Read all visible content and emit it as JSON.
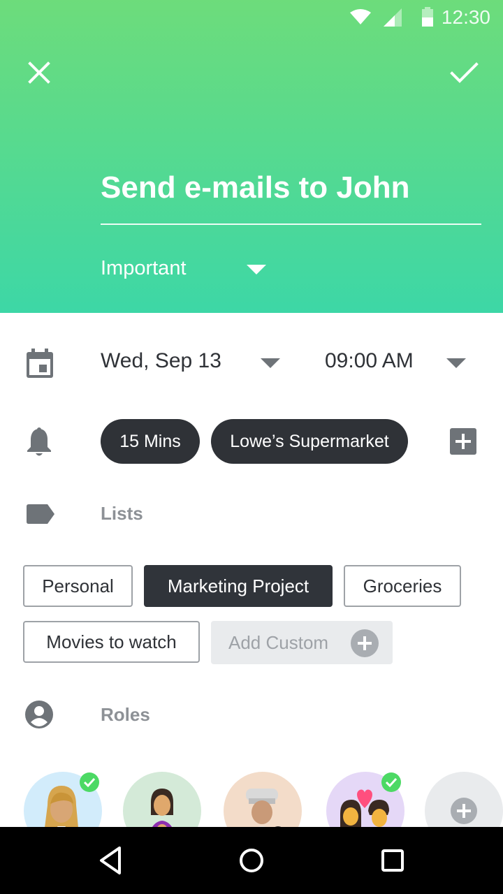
{
  "status_bar": {
    "time": "12:30",
    "icons": [
      "wifi-icon",
      "signal-icon",
      "battery-icon"
    ]
  },
  "header": {
    "close_icon": "close-icon",
    "confirm_icon": "check-icon",
    "title": "Send e-mails to John",
    "priority": "Important",
    "gradient": [
      "#6ddc7b",
      "#3dd7a6"
    ]
  },
  "schedule": {
    "date": "Wed, Sep 13",
    "time": "09:00 AM"
  },
  "reminders": {
    "items": [
      {
        "label": "15 Mins"
      },
      {
        "label": "Lowe’s Supermarket"
      }
    ]
  },
  "lists": {
    "label": "Lists",
    "chips": [
      {
        "label": "Personal",
        "selected": false
      },
      {
        "label": "Marketing Project",
        "selected": true
      },
      {
        "label": "Groceries",
        "selected": false
      },
      {
        "label": "Movies to watch",
        "selected": false
      }
    ],
    "add_custom": "Add Custom"
  },
  "roles": {
    "label": "Roles",
    "avatars": [
      {
        "icon": "woman-office-worker-icon",
        "bg": "#d2ecfb",
        "checked": true
      },
      {
        "icon": "woman-with-child-icon",
        "bg": "#d4ead8",
        "checked": false
      },
      {
        "icon": "woman-cook-icon",
        "bg": "#f3dcc9",
        "checked": false
      },
      {
        "icon": "couple-with-heart-icon",
        "bg": "#e5d8f7",
        "checked": true
      },
      {
        "icon": "add-role-icon",
        "bg": "#e9ebed",
        "checked": false
      }
    ]
  },
  "colors": {
    "accent_green": "#4cd964",
    "dark": "#2f3237",
    "muted": "#8d9196"
  }
}
